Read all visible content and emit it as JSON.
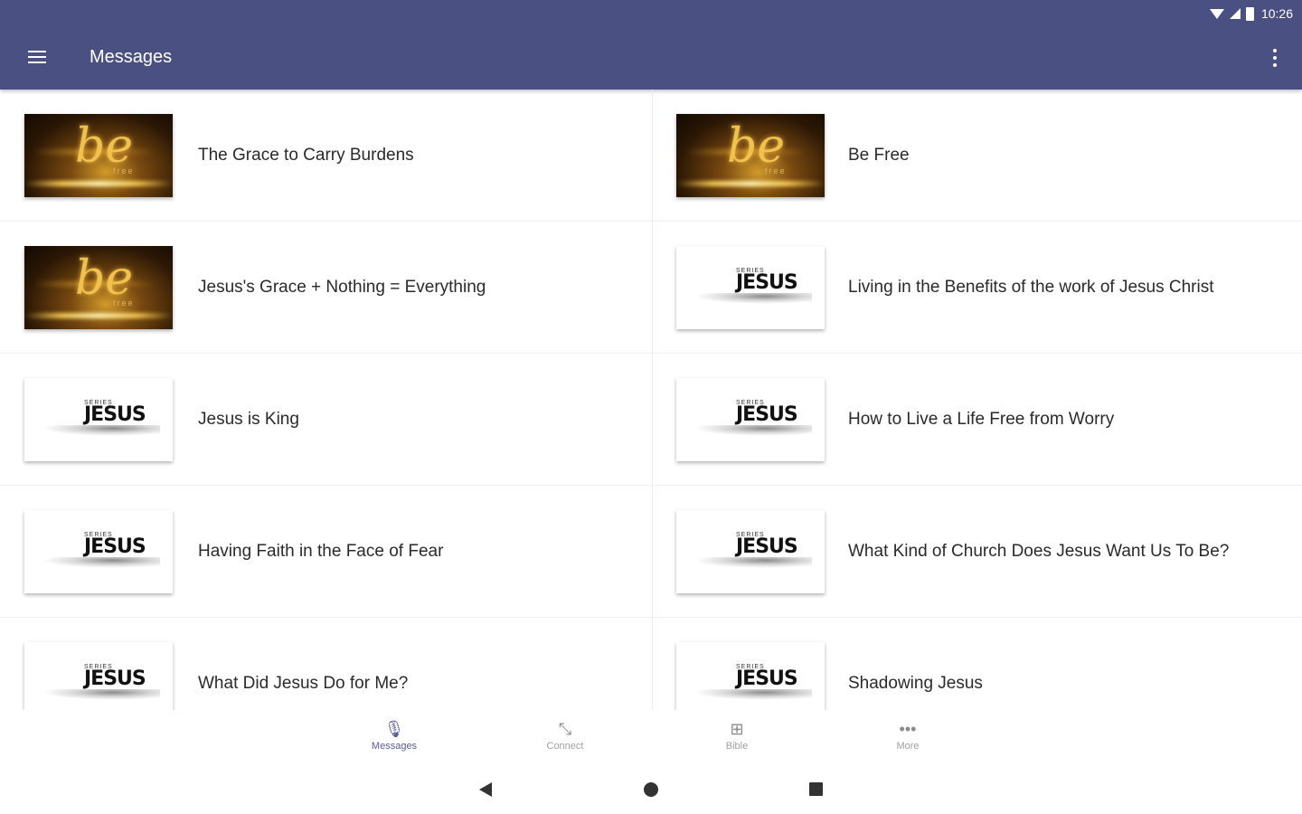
{
  "status_bar": {
    "time": "10:26"
  },
  "app_bar": {
    "title": "Messages"
  },
  "messages": [
    {
      "title": "The Grace to Carry Burdens",
      "thumbnail": "be-free"
    },
    {
      "title": "Be Free",
      "thumbnail": "be-free"
    },
    {
      "title": "Jesus's Grace + Nothing = Everything",
      "thumbnail": "be-free"
    },
    {
      "title": "Living in the Benefits of the work of Jesus Christ",
      "thumbnail": "jesus"
    },
    {
      "title": "Jesus is King",
      "thumbnail": "jesus"
    },
    {
      "title": "How to Live a Life Free from Worry",
      "thumbnail": "jesus"
    },
    {
      "title": "Having Faith in the Face of Fear",
      "thumbnail": "jesus"
    },
    {
      "title": "What Kind of Church Does Jesus Want Us To Be?",
      "thumbnail": "jesus"
    },
    {
      "title": "What Did Jesus Do for Me?",
      "thumbnail": "jesus"
    },
    {
      "title": "Shadowing Jesus",
      "thumbnail": "jesus"
    }
  ],
  "thumbnails": {
    "be_text": "be",
    "be_sub": "free",
    "jesus_word": "JESUS",
    "jesus_small": "SERIES"
  },
  "bottom_nav": [
    {
      "label": "Messages",
      "icon": "microphone-icon",
      "glyph": "🎙",
      "active": true
    },
    {
      "label": "Connect",
      "icon": "connect-icon",
      "glyph": "⤡",
      "active": false
    },
    {
      "label": "Bible",
      "icon": "bible-icon",
      "glyph": "⊞",
      "active": false
    },
    {
      "label": "More",
      "icon": "more-icon",
      "glyph": "•••",
      "active": false
    }
  ],
  "colors": {
    "app_bar": "#4b5083",
    "active_nav": "#5a5a9a"
  }
}
